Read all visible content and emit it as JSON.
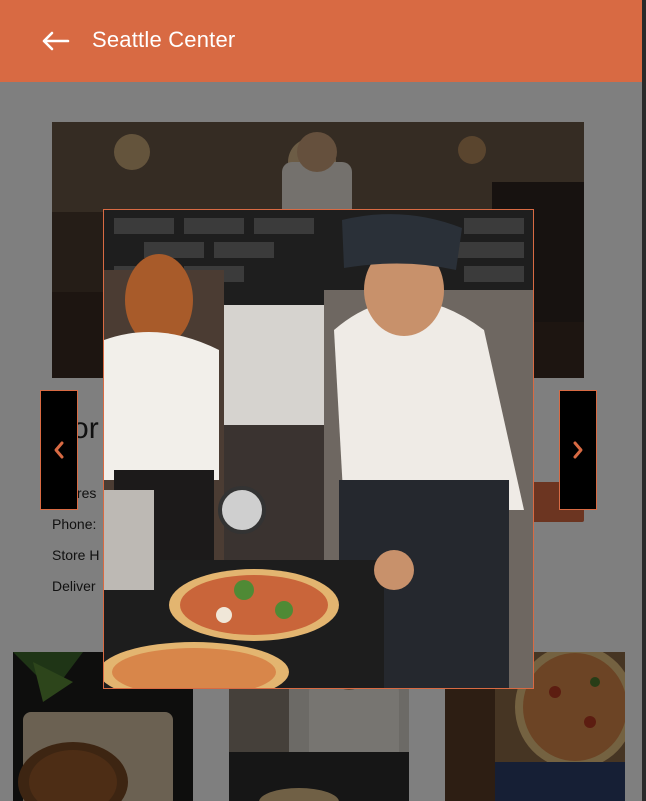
{
  "app_bar": {
    "title": "Seattle Center",
    "back_icon": "arrow-left-icon"
  },
  "store": {
    "name": "Por",
    "address_label": "Addres",
    "phone_label": "Phone:",
    "hours_label": "Store H",
    "delivery_label": "Deliver"
  },
  "images": {
    "hero": "restaurant-kitchen-photo",
    "thumbnails": [
      "pizza-photo",
      "pizza-chef-photo",
      "pizza-top-view-photo"
    ]
  },
  "lightbox": {
    "image": "chef-cutting-pizza-photo",
    "prev_icon": "chevron-left-icon",
    "next_icon": "chevron-right-icon"
  },
  "colors": {
    "accent": "#d86a43",
    "scrim": "rgba(0,0,0,0.5)",
    "nav_button_bg": "#000000"
  }
}
